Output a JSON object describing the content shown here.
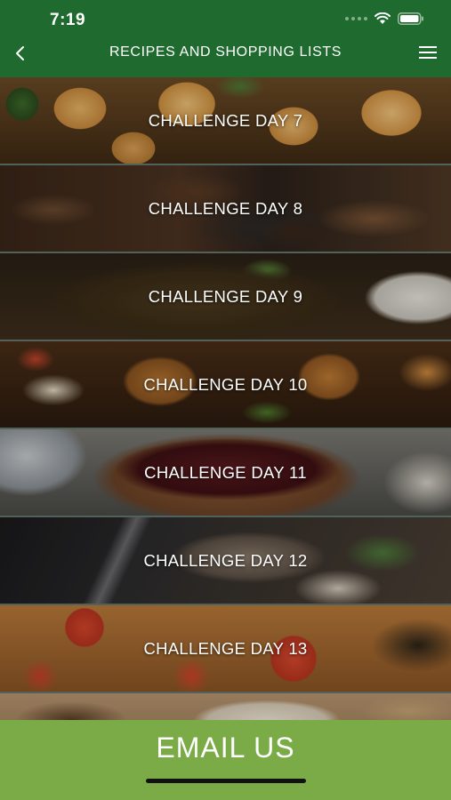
{
  "status_bar": {
    "time": "7:19",
    "icons": [
      "signal-icon",
      "wifi-icon",
      "battery-icon"
    ]
  },
  "header": {
    "title": "RECIPES AND SHOPPING LISTS",
    "back_icon": "chevron-left-icon",
    "menu_icon": "hamburger-menu-icon"
  },
  "challenges": [
    {
      "label": "CHALLENGE DAY 7"
    },
    {
      "label": "CHALLENGE DAY 8"
    },
    {
      "label": "CHALLENGE DAY 9"
    },
    {
      "label": "CHALLENGE DAY 10"
    },
    {
      "label": "CHALLENGE DAY 11"
    },
    {
      "label": "CHALLENGE DAY 12"
    },
    {
      "label": "CHALLENGE DAY 13"
    },
    {
      "label": ""
    }
  ],
  "footer": {
    "email_label": "EMAIL US"
  },
  "colors": {
    "header_green": "#1f6a2e",
    "footer_green": "#7aab46",
    "divider": "#51625a"
  }
}
